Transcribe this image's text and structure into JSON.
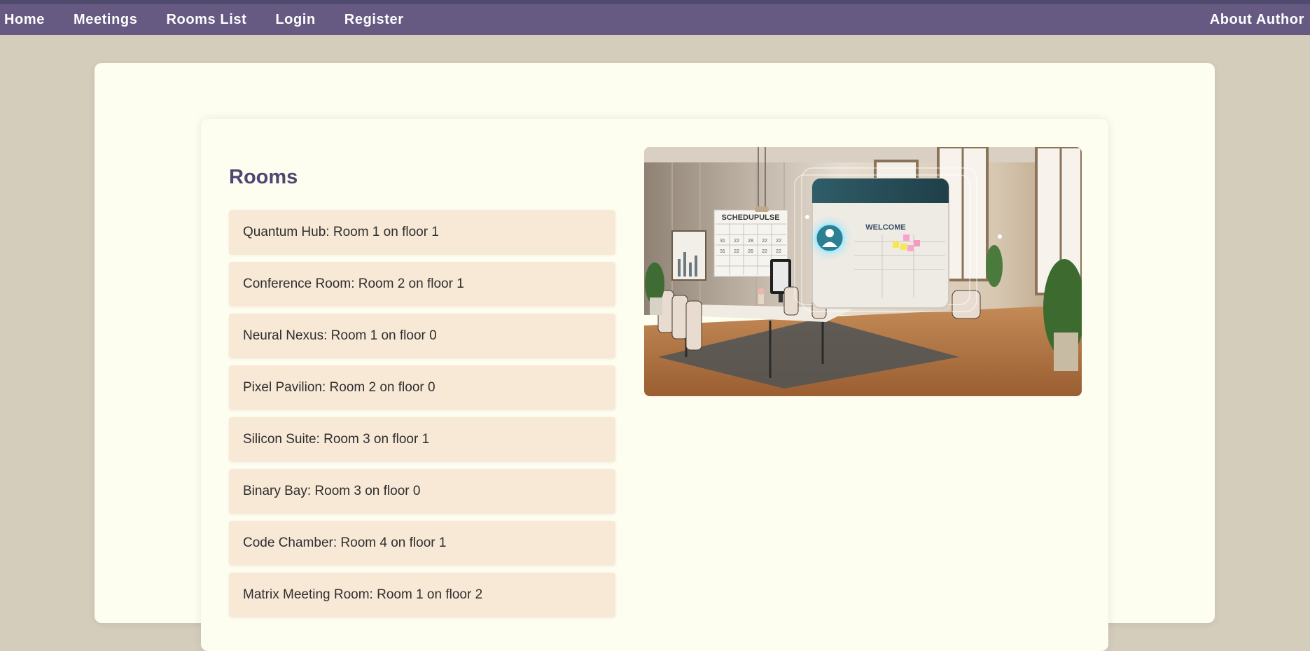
{
  "nav": {
    "links": [
      "Home",
      "Meetings",
      "Rooms List",
      "Login",
      "Register"
    ],
    "about": "About Author"
  },
  "main": {
    "title": "Rooms",
    "rooms": [
      "Quantum Hub: Room 1 on floor 1",
      "Conference Room: Room 2 on floor 1",
      "Neural Nexus: Room 1 on floor 0",
      "Pixel Pavilion: Room 2 on floor 0",
      "Silicon Suite: Room 3 on floor 1",
      "Binary Bay: Room 3 on floor 0",
      "Code Chamber: Room 4 on floor 1",
      "Matrix Meeting Room: Room 1 on floor 2"
    ]
  },
  "illustration": {
    "calendar_label": "SCHEDUPULSE",
    "screen_label": "WELCOME",
    "calendar_numbers": [
      "31",
      "22",
      "28",
      "22",
      "22",
      "31",
      "22",
      "26",
      "22",
      "22"
    ]
  }
}
